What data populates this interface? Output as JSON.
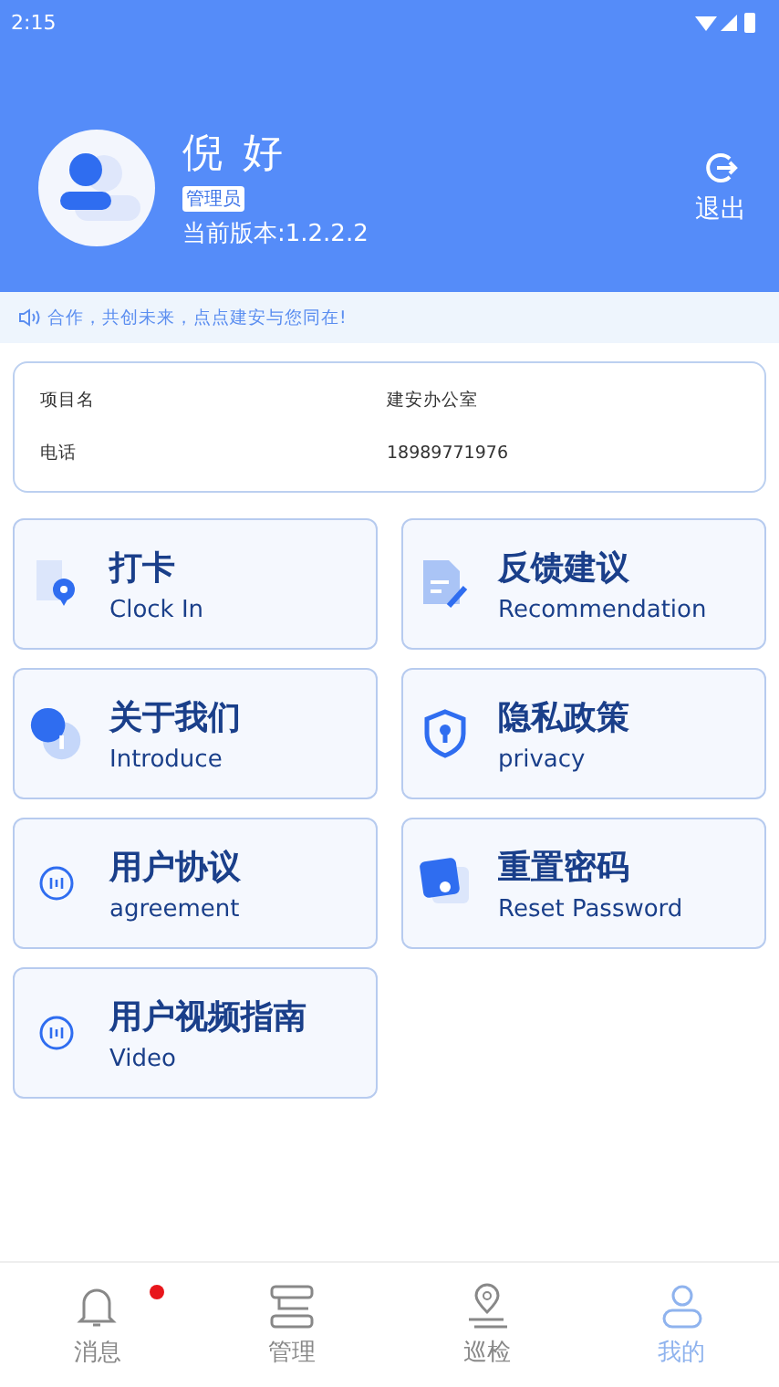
{
  "status_bar": {
    "time": "2:15"
  },
  "profile": {
    "name": "倪 好",
    "role": "管理员",
    "version": "当前版本:1.2.2.2",
    "logout": "退出"
  },
  "notice": "合作，共创未来，点点建安与您同在!",
  "info": [
    {
      "label": "项目名",
      "value": "建安办公室"
    },
    {
      "label": "电话",
      "value": "18989771976"
    }
  ],
  "menu": [
    {
      "kind": "clock",
      "title": "打卡",
      "subtitle": "Clock In"
    },
    {
      "kind": "feedback",
      "title": "反馈建议",
      "subtitle": "Recommendation"
    },
    {
      "kind": "about",
      "title": "关于我们",
      "subtitle": "Introduce"
    },
    {
      "kind": "privacy",
      "title": "隐私政策",
      "subtitle": "privacy"
    },
    {
      "kind": "doc",
      "title": "用户协议",
      "subtitle": "agreement"
    },
    {
      "kind": "reset",
      "title": "重置密码",
      "subtitle": "Reset Password"
    },
    {
      "kind": "doc",
      "title": "用户视频指南",
      "subtitle": "Video"
    }
  ],
  "tabs": [
    {
      "kind": "bell",
      "label": "消息",
      "selected": false,
      "badge": true
    },
    {
      "kind": "manage",
      "label": "管理",
      "selected": false,
      "badge": false
    },
    {
      "kind": "pin",
      "label": "巡检",
      "selected": false,
      "badge": false
    },
    {
      "kind": "user",
      "label": "我的",
      "selected": true,
      "badge": false
    }
  ]
}
